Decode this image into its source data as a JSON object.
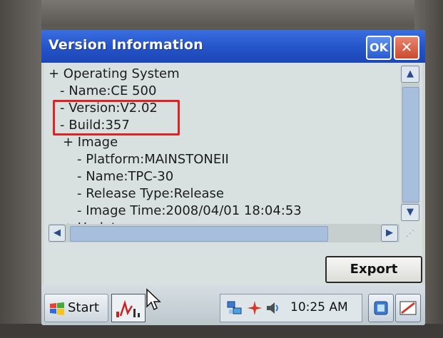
{
  "window": {
    "title": "Version Information",
    "ok_label": "OK",
    "close_glyph": "✕"
  },
  "tree": [
    {
      "text": "+ Operating System",
      "indent": 0
    },
    {
      "text": "- Name:CE 500",
      "indent": 1
    },
    {
      "text": "- Version:V2.02",
      "indent": 1
    },
    {
      "text": "- Build:357",
      "indent": 1
    },
    {
      "text": "+ Image",
      "indent": 1
    },
    {
      "text": "- Platform:MAINSTONEII",
      "indent": 2
    },
    {
      "text": "- Name:TPC-30",
      "indent": 2
    },
    {
      "text": "- Release Type:Release",
      "indent": 2
    },
    {
      "text": "- Image Time:2008/04/01 18:04:53",
      "indent": 2
    },
    {
      "text": "+ Updates",
      "indent": 1
    }
  ],
  "highlighted_items": [
    "- Version:V2.02",
    "- Build:357"
  ],
  "scrollbars": {
    "up_glyph": "▲",
    "down_glyph": "▼",
    "left_glyph": "◀",
    "right_glyph": "▶",
    "grip_glyph": "⋰"
  },
  "export_label": "Export",
  "taskbar": {
    "start_label": "Start",
    "clock": "10:25 AM",
    "task_icon": "chart-icon",
    "tray_icons": [
      "network-icon",
      "connection-icon",
      "volume-icon"
    ],
    "right_buttons": [
      "desktop-icon",
      "keyboard-icon"
    ]
  },
  "colors": {
    "title_bar": "#2453c9",
    "highlight": "#e22222",
    "screen_bg": "#d9e1e0"
  }
}
